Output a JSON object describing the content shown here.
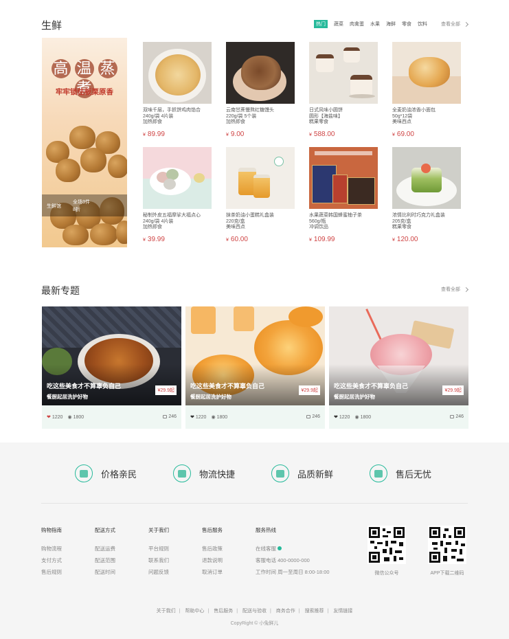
{
  "fresh": {
    "title": "生鲜",
    "tabs": [
      "热门",
      "蔬菜",
      "肉禽蛋",
      "水果",
      "海鲜",
      "零食",
      "饮料"
    ],
    "view_all": "查看全部",
    "banner": {
      "headline": [
        "高",
        "温",
        "蒸",
        "煮"
      ],
      "subtitle": "牢牢锁住板栗原香",
      "store": "生鲜馆",
      "promo_line1": "全场3件",
      "promo_line2": "8折"
    },
    "products": [
      {
        "lines": [
          "双味千层，手抓饼鸡肉馅合",
          "240g/袋 4片装",
          "加热即食"
        ],
        "price": "89.99",
        "img": "pancake"
      },
      {
        "lines": [
          "云南甘蔗慢熬红糖馒头",
          "220g/袋 5个装",
          "加热即食"
        ],
        "price": "9.00",
        "img": "bun"
      },
      {
        "lines": [
          "日式风味小圆饼",
          "圆形【海盐味】",
          "糕果零食"
        ],
        "price": "588.00",
        "img": "cakes"
      },
      {
        "lines": [
          "全麦奶油浓香小面包",
          "50g*12袋",
          "美味西点"
        ],
        "price": "69.00",
        "img": "bread"
      },
      {
        "lines": [
          "秘制外皮五福摩挲大福点心",
          "240g/袋 4片装",
          "加热即食"
        ],
        "price": "39.99",
        "img": "mochi"
      },
      {
        "lines": [
          "抹茶奶油小蛋糕礼盒装",
          "220克/盒",
          "美味西点"
        ],
        "price": "60.00",
        "img": "honey"
      },
      {
        "lines": [
          "水果蔬菜韩国蜂蜜柚子茶",
          "560g/瓶",
          "冲调饮品"
        ],
        "price": "109.99",
        "img": "giftbox"
      },
      {
        "lines": [
          "浓情比利时巧克力礼盒装",
          "205克/盒",
          "糕果零食"
        ],
        "price": "120.00",
        "img": "greencake"
      }
    ],
    "currency": "¥"
  },
  "topics": {
    "title": "最新专题",
    "view_all": "查看全部",
    "items": [
      {
        "title": "吃这些美食才不算辜负自己",
        "subtitle": "餐厨起居洗护好物",
        "price": "¥29.9起",
        "likes": "1220",
        "views": "1800",
        "comments": "246",
        "img": "dish"
      },
      {
        "title": "吃这些美食才不算辜负自己",
        "subtitle": "餐厨起居洗护好物",
        "price": "¥29.9起",
        "likes": "1220",
        "views": "1800",
        "comments": "246",
        "img": "orange"
      },
      {
        "title": "吃这些美食才不算辜负自己",
        "subtitle": "餐厨起居洗护好物",
        "price": "¥29.9起",
        "likes": "1220",
        "views": "1800",
        "comments": "246",
        "img": "icecream"
      }
    ]
  },
  "footer": {
    "services": [
      "价格亲民",
      "物流快捷",
      "品质新鲜",
      "售后无忧"
    ],
    "columns": [
      {
        "heading": "购物指南",
        "items": [
          "购物流程",
          "支付方式",
          "售后规则"
        ]
      },
      {
        "heading": "配送方式",
        "items": [
          "配送运费",
          "配送范围",
          "配送时间"
        ]
      },
      {
        "heading": "关于我们",
        "items": [
          "平台规则",
          "联系我们",
          "问题反馈"
        ]
      },
      {
        "heading": "售后服务",
        "items": [
          "售后政策",
          "退款说明",
          "取消订单"
        ]
      },
      {
        "heading": "服务热线",
        "items": [
          "在线客服",
          "客服电话 400-0000-000",
          "工作时间 周一至周日 8:00-18:00"
        ]
      }
    ],
    "qr": [
      "微信公众号",
      "APP下载二维码"
    ],
    "links": [
      "关于我们",
      "帮助中心",
      "售后服务",
      "配送与验收",
      "商务合作",
      "搜索推荐",
      "友情链接"
    ],
    "copyright": "CopyRight © 小兔鲜儿"
  },
  "colors": {
    "accent": "#27ba9b",
    "price": "#cf4444",
    "footer_bg": "#f5f5f5",
    "topic_bg": "#eff7f3"
  }
}
